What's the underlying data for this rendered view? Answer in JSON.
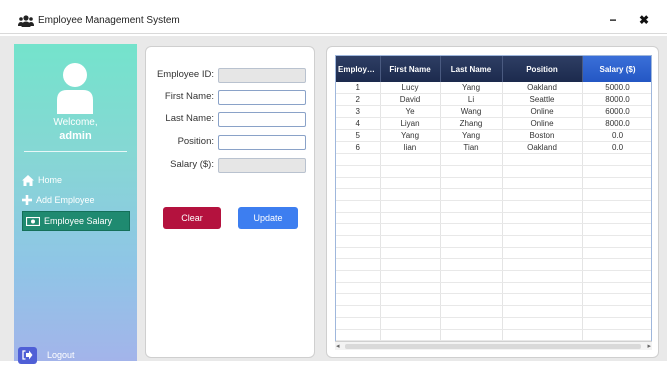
{
  "window": {
    "title": "Employee Management System",
    "minimize_label": "−",
    "close_label": "✖"
  },
  "sidebar": {
    "welcome": "Welcome,",
    "username": "admin",
    "items": [
      {
        "label": "Home",
        "icon": "home-icon"
      },
      {
        "label": "Add Employee",
        "icon": "plus-icon"
      },
      {
        "label": "Employee Salary",
        "icon": "money-icon",
        "active": true
      }
    ],
    "logout_label": "Logout",
    "active_color": "#1f8a70"
  },
  "form": {
    "fields": [
      {
        "label": "Employee ID:",
        "value": "",
        "disabled": true
      },
      {
        "label": "First Name:",
        "value": "",
        "disabled": false
      },
      {
        "label": "Last Name:",
        "value": "",
        "disabled": false
      },
      {
        "label": "Position:",
        "value": "",
        "disabled": false
      },
      {
        "label": "Salary ($):",
        "value": "",
        "disabled": true
      }
    ],
    "clear_label": "Clear",
    "update_label": "Update",
    "clear_color": "#b4123e",
    "update_color": "#3d7ef0"
  },
  "table": {
    "columns": [
      "Employee...",
      "First Name",
      "Last Name",
      "Position",
      "Salary ($)"
    ],
    "rows": [
      [
        "1",
        "Lucy",
        "Yang",
        "Oakland",
        "5000.0"
      ],
      [
        "2",
        "David",
        "Li",
        "Seattle",
        "8000.0"
      ],
      [
        "3",
        "Ye",
        "Wang",
        "Online",
        "6000.0"
      ],
      [
        "4",
        "Liyan",
        "Zhang",
        "Online",
        "8000.0"
      ],
      [
        "5",
        "Yang",
        "Yang",
        "Boston",
        "0.0"
      ],
      [
        "6",
        "lian",
        "Tian",
        "Oakland",
        "0.0"
      ]
    ],
    "empty_rows": 16
  }
}
